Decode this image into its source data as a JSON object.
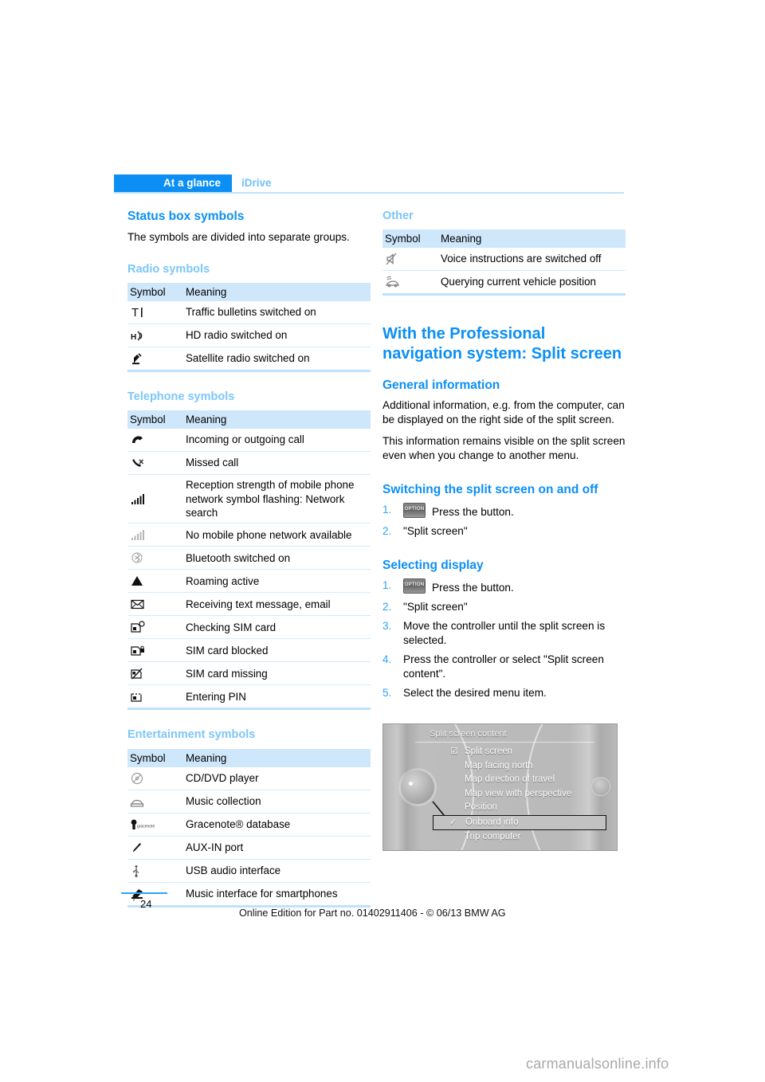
{
  "header": {
    "tab_active": "At a glance",
    "tab_inactive": "iDrive"
  },
  "left_column": {
    "title": "Status box symbols",
    "intro": "The symbols are divided into separate groups.",
    "sections": [
      {
        "heading": "Radio symbols",
        "columns": [
          "Symbol",
          "Meaning"
        ],
        "rows": [
          {
            "icon": "traffic-bulletins-icon",
            "meaning": "Traffic bulletins switched on"
          },
          {
            "icon": "hd-radio-icon",
            "meaning": "HD radio switched on"
          },
          {
            "icon": "satellite-radio-icon",
            "meaning": "Satellite radio switched on"
          }
        ]
      },
      {
        "heading": "Telephone symbols",
        "columns": [
          "Symbol",
          "Meaning"
        ],
        "rows": [
          {
            "icon": "handset-icon",
            "meaning": "Incoming or outgoing call"
          },
          {
            "icon": "missed-call-icon",
            "meaning": "Missed call"
          },
          {
            "icon": "signal-bars-full-icon",
            "meaning": "Reception strength of mobile phone network symbol flashing: Network search"
          },
          {
            "icon": "signal-bars-grey-icon",
            "meaning": "No mobile phone network available"
          },
          {
            "icon": "bluetooth-icon",
            "meaning": "Bluetooth switched on"
          },
          {
            "icon": "roaming-triangle-icon",
            "meaning": "Roaming active"
          },
          {
            "icon": "envelope-icon",
            "meaning": "Receiving text message, email"
          },
          {
            "icon": "sim-checking-icon",
            "meaning": "Checking SIM card"
          },
          {
            "icon": "sim-blocked-icon",
            "meaning": "SIM card blocked"
          },
          {
            "icon": "sim-missing-icon",
            "meaning": "SIM card missing"
          },
          {
            "icon": "sim-pin-icon",
            "meaning": "Entering PIN"
          }
        ]
      },
      {
        "heading": "Entertainment symbols",
        "columns": [
          "Symbol",
          "Meaning"
        ],
        "rows": [
          {
            "icon": "cd-dvd-icon",
            "meaning": "CD/DVD player"
          },
          {
            "icon": "music-collection-icon",
            "meaning": "Music collection"
          },
          {
            "icon": "gracenote-icon",
            "meaning": "Gracenote® database"
          },
          {
            "icon": "aux-in-icon",
            "meaning": "AUX-IN port"
          },
          {
            "icon": "usb-icon",
            "meaning": "USB audio interface"
          },
          {
            "icon": "smartphone-interface-icon",
            "meaning": "Music interface for smartphones"
          }
        ]
      }
    ]
  },
  "right_column": {
    "other_section": {
      "heading": "Other",
      "columns": [
        "Symbol",
        "Meaning"
      ],
      "rows": [
        {
          "icon": "voice-muted-icon",
          "meaning": "Voice instructions are switched off"
        },
        {
          "icon": "vehicle-position-icon",
          "meaning": "Querying current vehicle position"
        }
      ]
    },
    "main_heading": "With the Professional navigation system: Split screen",
    "general": {
      "heading": "General information",
      "paragraphs": [
        "Additional information, e.g. from the computer, can be displayed on the right side of the split screen.",
        "This information remains visible on the split screen even when you change to another menu."
      ]
    },
    "switching": {
      "heading": "Switching the split screen on and off",
      "steps": [
        {
          "num": "1.",
          "button": "OPTION",
          "text": "Press the button."
        },
        {
          "num": "2.",
          "text": "\"Split screen\""
        }
      ]
    },
    "selecting": {
      "heading": "Selecting display",
      "steps": [
        {
          "num": "1.",
          "button": "OPTION",
          "text": "Press the button."
        },
        {
          "num": "2.",
          "text": "\"Split screen\""
        },
        {
          "num": "3.",
          "text": "Move the controller until the split screen is selected."
        },
        {
          "num": "4.",
          "text": "Press the controller or select \"Split screen content\"."
        },
        {
          "num": "5.",
          "text": "Select the desired menu item."
        }
      ]
    },
    "figure": {
      "title": "Split screen content",
      "items": [
        {
          "label": "Split screen",
          "mark": "☑",
          "selected": false
        },
        {
          "label": "Map facing north",
          "mark": "",
          "selected": false
        },
        {
          "label": "Map direction of travel",
          "mark": "",
          "selected": false
        },
        {
          "label": "Map view with perspective",
          "mark": "",
          "selected": false
        },
        {
          "label": "Position",
          "mark": "",
          "selected": false
        },
        {
          "label": "Onboard info",
          "mark": "✓",
          "selected": true
        },
        {
          "label": "Trip computer",
          "mark": "",
          "selected": false
        }
      ]
    }
  },
  "footer": {
    "page_number": "24",
    "note": "Online Edition for Part no. 01402911406 - © 06/13 BMW AG",
    "watermark": "carmanualsonline.info"
  },
  "colors": {
    "accent_blue": "#0b8ff5",
    "light_blue": "#7cc6fa",
    "table_header": "#cfe7fb",
    "rule": "#bfe2fb"
  }
}
